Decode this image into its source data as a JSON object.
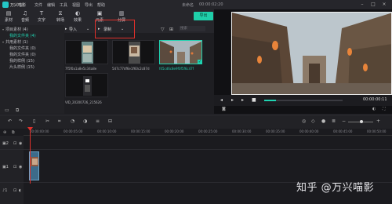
{
  "app": {
    "name": "万兴喵影",
    "menus": [
      "文件",
      "编辑",
      "工具",
      "视图",
      "导出",
      "帮助"
    ],
    "unsaved": "未命名",
    "timecode": "00:00:02:20"
  },
  "toolbar": {
    "items": [
      {
        "label": "素材",
        "icon": "folder-icon"
      },
      {
        "label": "音频",
        "icon": "music-icon"
      },
      {
        "label": "文字",
        "icon": "text-icon"
      },
      {
        "label": "转场",
        "icon": "transition-icon"
      },
      {
        "label": "效果",
        "icon": "effects-icon"
      },
      {
        "label": "元素",
        "icon": "elements-icon"
      },
      {
        "label": "分屏",
        "icon": "split-screen-icon"
      }
    ],
    "export_label": "导出"
  },
  "sidebar": {
    "items": [
      {
        "label": "项目素材 (4)",
        "selected": false,
        "arrow": true
      },
      {
        "label": "我的文件夹 (4)",
        "selected": true,
        "arrow": false
      },
      {
        "label": "共用素材 (1)",
        "selected": false,
        "arrow": true
      },
      {
        "label": "我的文件夹 (0)",
        "selected": false,
        "arrow": false
      },
      {
        "label": "我的文件夹 (0)",
        "selected": false,
        "arrow": false
      },
      {
        "label": "我的样例 (15)",
        "selected": false,
        "arrow": false
      },
      {
        "label": "片头样例 (15)",
        "selected": false,
        "arrow": false
      }
    ]
  },
  "media": {
    "import_label": "导入",
    "record_label": "录制",
    "search_placeholder": "搜索",
    "thumbs": [
      {
        "caption": "7f5f0a1a8e5c34a8e",
        "selected": false
      },
      {
        "caption": "547c77df6e1f60c2c87d",
        "selected": false
      },
      {
        "caption": "f45cd6c8e9f0f5f6c47f",
        "selected": true
      },
      {
        "caption": "VID_20200726_215626",
        "selected": false
      }
    ]
  },
  "preview": {
    "time": "00:00:00:11",
    "progress": 0.15
  },
  "timeline": {
    "ruler": [
      "00:00:00:00",
      "00:00:05:00",
      "00:00:10:00",
      "00:00:15:00",
      "00:00:20:00",
      "00:00:25:00",
      "00:00:30:00",
      "00:00:35:00",
      "00:00:40:00",
      "00:00:45:00",
      "00:00:50:00"
    ],
    "tracks": [
      {
        "label": "2"
      },
      {
        "label": "1"
      },
      {
        "label": "1"
      }
    ]
  },
  "watermark": "知乎 @万兴喵影",
  "colors": {
    "accent": "#1fd3b1",
    "highlight_box": "#e0302b",
    "background": "#1b1b1f"
  }
}
